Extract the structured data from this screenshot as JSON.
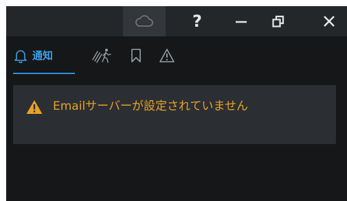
{
  "titlebar": {
    "icons": {
      "cloud": "cloud-icon",
      "help": "?",
      "minimize": "minimize-icon",
      "restore": "restore-icon",
      "close": "close-icon"
    }
  },
  "tabs": [
    {
      "label": "通知",
      "icon": "bell-icon",
      "active": true
    },
    {
      "label": "",
      "icon": "motion-detection-icon",
      "active": false
    },
    {
      "label": "",
      "icon": "bookmark-icon",
      "active": false
    },
    {
      "label": "",
      "icon": "warning-icon",
      "active": false
    }
  ],
  "message": {
    "text": "Emailサーバーが設定されていません",
    "icon": "warning-icon"
  },
  "colors": {
    "accent": "#3ea0e6",
    "warning": "#e8a224",
    "panel_bg": "#151719",
    "titlebar_bg": "#24272a",
    "card_bg": "#2b2f33"
  }
}
